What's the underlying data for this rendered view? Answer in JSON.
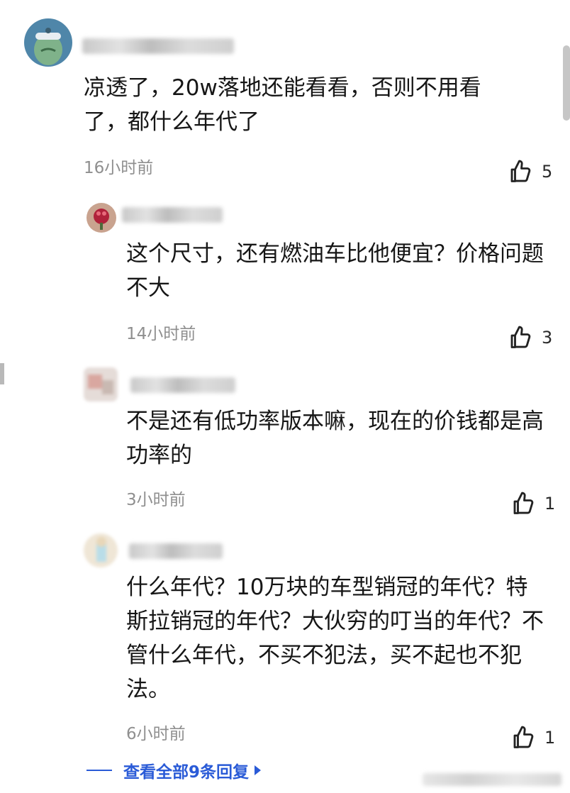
{
  "comments": [
    {
      "text": "凉透了，20w落地还能看看，否则不用看了，都什么年代了",
      "time": "16小时前",
      "likes": "5"
    },
    {
      "text": "这个尺寸，还有燃油车比他便宜？价格问题不大",
      "time": "14小时前",
      "likes": "3"
    },
    {
      "text": "不是还有低功率版本嘛，现在的价钱都是高功率的",
      "time": "3小时前",
      "likes": "1"
    },
    {
      "text": "什么年代？10万块的车型销冠的年代？特斯拉销冠的年代？大伙穷的叮当的年代？不管什么年代，不买不犯法，买不起也不犯法。",
      "time": "6小时前",
      "likes": "1"
    }
  ],
  "footer": {
    "view_all_replies": "查看全部9条回复"
  },
  "icons": {
    "like": "thumbs-up-icon",
    "arrow": "right-triangle-icon"
  },
  "colors": {
    "link": "#2a5bd7",
    "time": "#8f8f8f"
  }
}
